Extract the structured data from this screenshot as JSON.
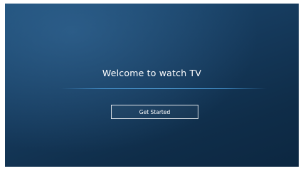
{
  "welcome": {
    "title": "Welcome to watch TV",
    "button_label": "Get Started"
  }
}
